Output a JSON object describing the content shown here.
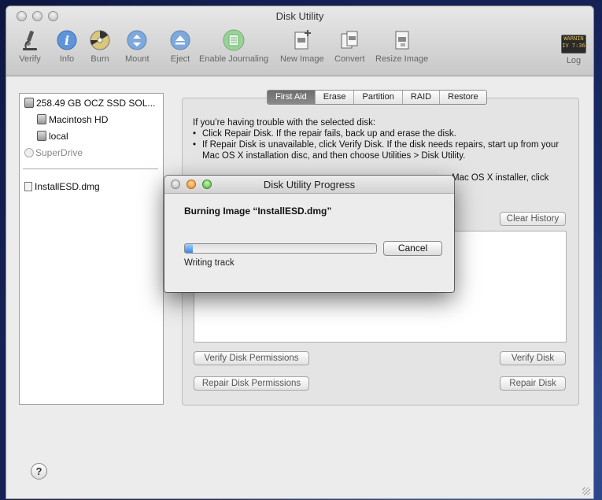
{
  "window": {
    "title": "Disk Utility"
  },
  "toolbar": {
    "items": [
      {
        "label": "Verify",
        "icon": "microscope-icon"
      },
      {
        "label": "Info",
        "icon": "info-icon"
      },
      {
        "label": "Burn",
        "icon": "burn-disc-icon"
      },
      {
        "label": "Mount",
        "icon": "mount-icon"
      },
      {
        "label": "Eject",
        "icon": "eject-icon"
      },
      {
        "label": "Enable Journaling",
        "icon": "journaling-icon"
      },
      {
        "label": "New Image",
        "icon": "new-image-icon"
      },
      {
        "label": "Convert",
        "icon": "convert-icon"
      },
      {
        "label": "Resize Image",
        "icon": "resize-image-icon"
      }
    ],
    "log_label": "Log",
    "log_icon_text": "WARNIN\nIV 7:36"
  },
  "sidebar": {
    "disk_label": "258.49 GB OCZ SSD SOL...",
    "volumes": [
      "Macintosh HD",
      "local"
    ],
    "superdrive_label": "SuperDrive",
    "image_label": "InstallESD.dmg"
  },
  "tabs": [
    "First Aid",
    "Erase",
    "Partition",
    "RAID",
    "Restore"
  ],
  "active_tab": "First Aid",
  "first_aid": {
    "intro": "If you’re having trouble with the selected disk:",
    "bullet_1": "Click Repair Disk. If the repair fails, back up and erase the disk.",
    "bullet_2": "If Repair Disk is unavailable, click Verify Disk. If the disk needs repairs, start up from your Mac OS X installation disc, and then choose Utilities > Disk Utility.",
    "partial_line": "Mac OS X installer, click",
    "clear_history_label": "Clear History",
    "verify_permissions_label": "Verify Disk Permissions",
    "repair_permissions_label": "Repair Disk Permissions",
    "verify_disk_label": "Verify Disk",
    "repair_disk_label": "Repair Disk"
  },
  "help_symbol": "?",
  "progress_dialog": {
    "title": "Disk Utility Progress",
    "heading": "Burning Image “InstallESD.dmg”",
    "status": "Writing track",
    "cancel_label": "Cancel",
    "progress_fraction": 0.04
  }
}
